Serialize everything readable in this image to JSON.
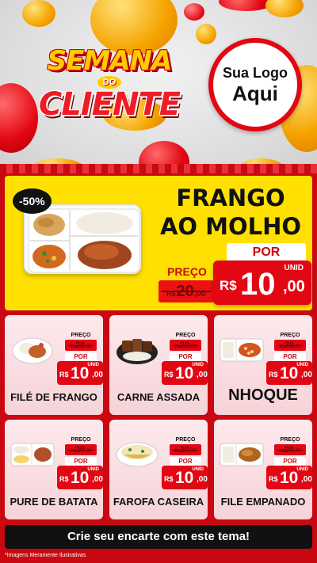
{
  "header": {
    "title_line1": "SEMANA",
    "title_connector": "DO",
    "title_line2": "CLIENTE",
    "logo_line1": "Sua Logo",
    "logo_line2": "Aqui"
  },
  "featured": {
    "discount": "-50%",
    "name_line1": "FRANGO",
    "name_line2": "AO MOLHO",
    "price_label": "PREÇO",
    "old_currency": "R$",
    "old_int": "20",
    "old_dec": ",00",
    "por_label": "POR",
    "unit_label": "UNID",
    "new_currency": "R$",
    "new_int": "10",
    "new_dec": ",00"
  },
  "products": [
    {
      "name": "FILÉ DE FRANGO",
      "price_label": "PREÇO",
      "old_currency": "R$",
      "old_int": "20",
      "old_dec": ",00",
      "por_label": "POR",
      "unit_label": "UNID",
      "new_currency": "R$",
      "new_int": "10",
      "new_dec": ",00",
      "icon": "bowl-chicken-icon"
    },
    {
      "name": "CARNE ASSADA",
      "price_label": "PREÇO",
      "old_currency": "R$",
      "old_int": "20",
      "old_dec": ",00",
      "por_label": "POR",
      "unit_label": "UNID",
      "new_currency": "R$",
      "new_int": "10",
      "new_dec": ",00",
      "icon": "bowl-beef-icon"
    },
    {
      "name": "NHOQUE",
      "price_label": "PREÇO",
      "old_currency": "R$",
      "old_int": "20",
      "old_dec": ",00",
      "por_label": "POR",
      "unit_label": "UNID",
      "new_currency": "R$",
      "new_int": "10",
      "new_dec": ",00",
      "icon": "tray-gnocchi-icon"
    },
    {
      "name": "PURE DE BATATA",
      "price_label": "PREÇO",
      "old_currency": "R$",
      "old_int": "20",
      "old_dec": ",00",
      "por_label": "POR",
      "unit_label": "UNID",
      "new_currency": "R$",
      "new_int": "10",
      "new_dec": ",00",
      "icon": "tray-pure-icon"
    },
    {
      "name": "FAROFA CASEIRA",
      "price_label": "PREÇO",
      "old_currency": "R$",
      "old_int": "20",
      "old_dec": ",00",
      "por_label": "POR",
      "unit_label": "UNID",
      "new_currency": "R$",
      "new_int": "10",
      "new_dec": ",00",
      "icon": "bowl-farofa-icon"
    },
    {
      "name": "FILE EMPANADO",
      "price_label": "PREÇO",
      "old_currency": "R$",
      "old_int": "20",
      "old_dec": ",00",
      "por_label": "POR",
      "unit_label": "UNID",
      "new_currency": "R$",
      "new_int": "10",
      "new_dec": ",00",
      "icon": "tray-breaded-icon"
    }
  ],
  "footer": {
    "cta": "Crie seu encarte com este tema!",
    "note": "*Imagens Meramente Ilustrativas"
  },
  "colors": {
    "brand_red": "#e30613",
    "background_red": "#c90812",
    "highlight_yellow": "#ffe000"
  }
}
